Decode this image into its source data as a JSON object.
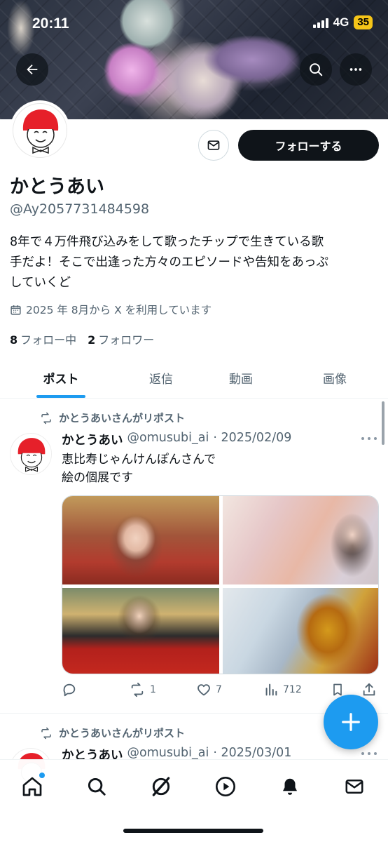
{
  "status_bar": {
    "time": "20:11",
    "network": "4G",
    "battery": "35"
  },
  "header": {
    "back_icon": "arrow-left-icon",
    "search_icon": "search-icon",
    "more_icon": "more-horizontal-icon"
  },
  "profile": {
    "display_name": "かとうあい",
    "handle": "@Ay2057731484598",
    "bio_lines": [
      "8年で４万件飛び込みをして歌ったチップで生きている歌",
      "手だよ！そこで出逢った方々のエピソードや告知をあっぷ",
      "していくど"
    ],
    "joined": "2025 年 8月から X を利用しています",
    "following_count": "8",
    "following_label": "フォロー中",
    "followers_count": "2",
    "followers_label": "フォロワー",
    "follow_button": "フォローする",
    "message_icon": "mail-icon"
  },
  "tabs": [
    {
      "label": "ポスト",
      "active": true
    },
    {
      "label": "返信",
      "active": false
    },
    {
      "label": "動画",
      "active": false
    },
    {
      "label": "画像",
      "active": false
    }
  ],
  "posts": [
    {
      "repost_label": "かとうあいさんがリポスト",
      "author": "かとうあい",
      "handle": "@omusubi_ai",
      "date": "· 2025/02/09",
      "text_lines": [
        "恵比寿じゃんけんぽんさんで",
        "絵の個展です"
      ],
      "replies": "",
      "reposts": "1",
      "likes": "7",
      "views": "712"
    },
    {
      "repost_label": "かとうあいさんがリポスト",
      "author": "かとうあい",
      "handle": "@omusubi_ai",
      "date": "· 2025/03/01"
    }
  ],
  "bottom_nav": [
    "home-icon",
    "search-icon",
    "grok-icon",
    "video-icon",
    "notifications-icon",
    "messages-icon"
  ],
  "colors": {
    "accent": "#1d9bf0",
    "text": "#0f1419",
    "secondary": "#536471"
  }
}
